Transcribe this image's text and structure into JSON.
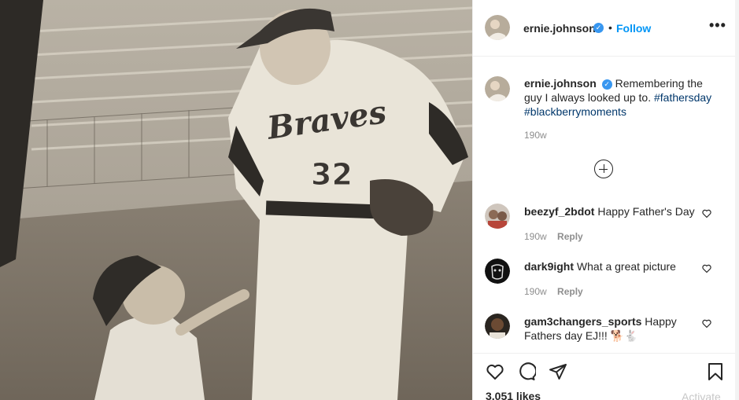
{
  "post": {
    "username": "ernie.johnson",
    "follow_label": "Follow",
    "caption": "Remembering the guy I always looked up to.",
    "hashtags": [
      "#fathersday",
      "#blackberrymoments"
    ],
    "time": "190w",
    "likes": "3,051 likes",
    "photo_jersey_text": "Braves",
    "photo_number": "32"
  },
  "comments": [
    {
      "username": "beezyf_2bdot",
      "text": "Happy Father's Day",
      "time": "190w",
      "reply": "Reply"
    },
    {
      "username": "dark9ight",
      "text": "What a great picture",
      "time": "190w",
      "reply": "Reply"
    },
    {
      "username": "gam3changers_sports",
      "text": "Happy Fathers day EJ!!! 🐕🐇",
      "time": "",
      "reply": ""
    }
  ],
  "icons": [
    "verified-badge-icon",
    "more-options-icon",
    "load-more-comments-icon",
    "heart-icon",
    "comment-icon",
    "share-icon",
    "bookmark-icon"
  ],
  "colors": {
    "link": "#0095f6",
    "verified": "#3897f0",
    "hashtag": "#00376b",
    "muted": "#8e8e8e"
  },
  "watermark": "Activate"
}
